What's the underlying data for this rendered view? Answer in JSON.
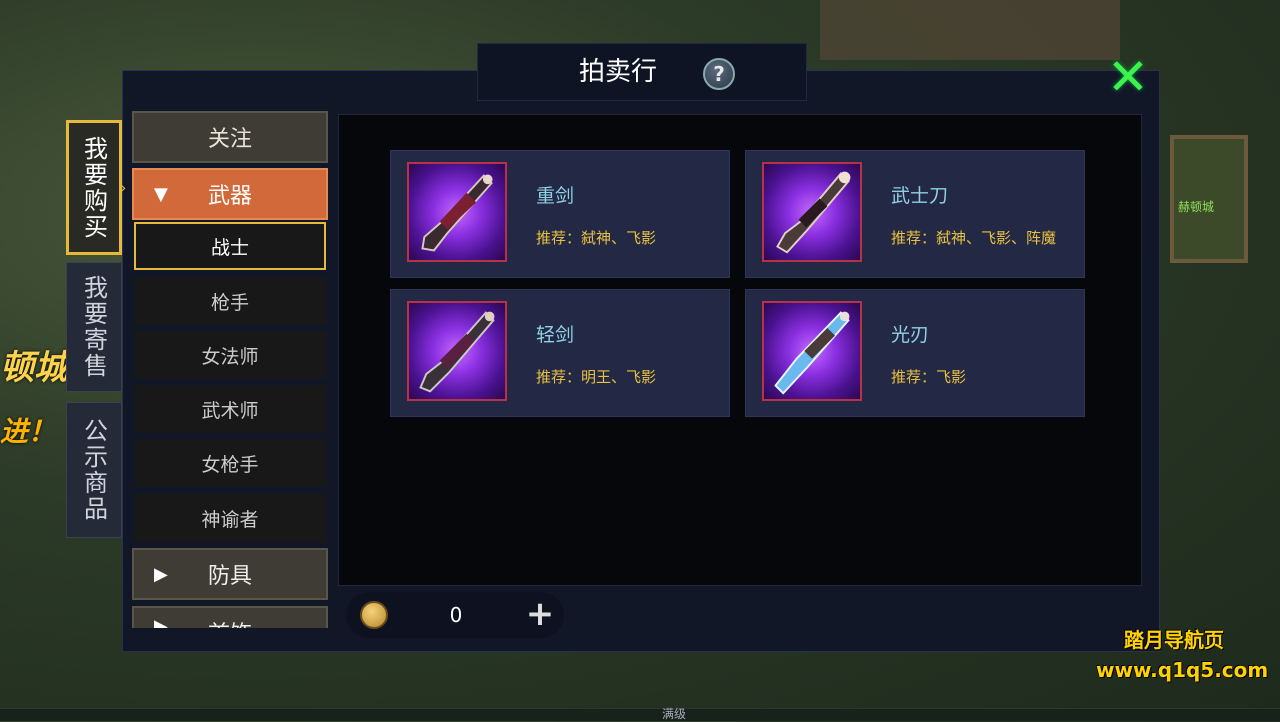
{
  "background": {
    "sign_text": "赫顿城",
    "left_banner_1": "顿城",
    "left_banner_2": "进！",
    "level_text": "满级"
  },
  "window": {
    "title": "拍卖行",
    "help_icon": "?",
    "close_icon": "✕"
  },
  "side_tabs": [
    {
      "label": "我要购买",
      "active": true
    },
    {
      "label": "我要寄售",
      "active": false
    },
    {
      "label": "公示商品",
      "active": false
    }
  ],
  "categories": {
    "follow": "关注",
    "weapon": "武器",
    "armor": "防具",
    "accessory": "首饰"
  },
  "subcategories": [
    "战士",
    "枪手",
    "女法师",
    "武术师",
    "女枪手",
    "神谕者"
  ],
  "items": [
    {
      "name": "重剑",
      "recommend": "推荐：弑神、飞影",
      "icon": "greatsword-icon"
    },
    {
      "name": "武士刀",
      "recommend": "推荐：弑神、飞影、阵魔",
      "icon": "katana-icon"
    },
    {
      "name": "轻剑",
      "recommend": "推荐：明王、飞影",
      "icon": "lightsword-icon"
    },
    {
      "name": "光刃",
      "recommend": "推荐：飞影",
      "icon": "lightblade-icon"
    }
  ],
  "currency": {
    "amount": "0",
    "add": "+"
  },
  "watermark": {
    "line1": "踏月导航页",
    "line2": "www.q1q5.com"
  },
  "colors": {
    "accent_gold": "#e6b93a",
    "active_orange": "#d2693a",
    "close_green": "#3df24a",
    "item_name": "#8fd0e6",
    "item_recommend": "#e8c040"
  }
}
